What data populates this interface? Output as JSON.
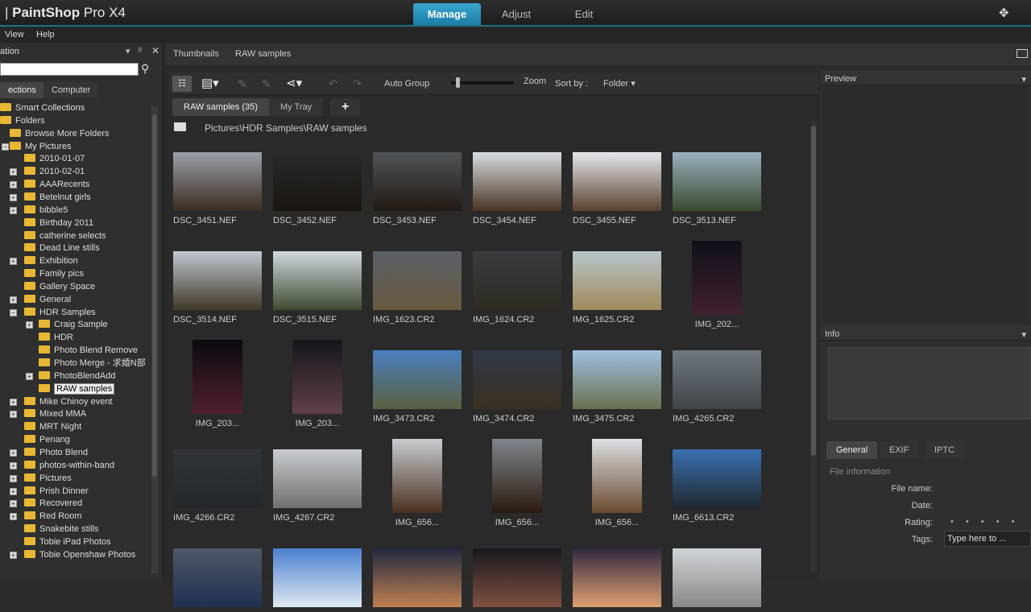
{
  "app": {
    "title_bold": "PaintShop",
    "title_rest": " Pro X4"
  },
  "modes": [
    "Manage",
    "Adjust",
    "Edit"
  ],
  "menu": [
    "View",
    "Help"
  ],
  "nav": {
    "title": "ation",
    "tabs": [
      "ections",
      "Computer"
    ],
    "tree": [
      {
        "label": "Smart Collections",
        "level": 0,
        "exp": ""
      },
      {
        "label": "Folders",
        "level": 0,
        "exp": ""
      },
      {
        "label": "Browse More Folders",
        "level": 1,
        "exp": ""
      },
      {
        "label": "My Pictures",
        "level": 1,
        "exp": "-"
      },
      {
        "label": "2010-01-07",
        "level": 2,
        "exp": ""
      },
      {
        "label": "2010-02-01",
        "level": 2,
        "exp": "+"
      },
      {
        "label": "AAARecents",
        "level": 2,
        "exp": "+"
      },
      {
        "label": "Betelnut girls",
        "level": 2,
        "exp": "+"
      },
      {
        "label": "bibble5",
        "level": 2,
        "exp": "+"
      },
      {
        "label": "Birthday 2011",
        "level": 2,
        "exp": ""
      },
      {
        "label": "catherine selects",
        "level": 2,
        "exp": ""
      },
      {
        "label": "Dead Line stills",
        "level": 2,
        "exp": ""
      },
      {
        "label": "Exhibition",
        "level": 2,
        "exp": "+"
      },
      {
        "label": "Family pics",
        "level": 2,
        "exp": ""
      },
      {
        "label": "Gallery Space",
        "level": 2,
        "exp": ""
      },
      {
        "label": "General",
        "level": 2,
        "exp": "+"
      },
      {
        "label": "HDR Samples",
        "level": 2,
        "exp": "-"
      },
      {
        "label": "Craig Sample",
        "level": 3,
        "exp": "+"
      },
      {
        "label": "HDR",
        "level": 3,
        "exp": ""
      },
      {
        "label": "Photo Blend Remove",
        "level": 3,
        "exp": ""
      },
      {
        "label": "Photo Merge - 求婚N部",
        "level": 3,
        "exp": ""
      },
      {
        "label": "PhotoBlendAdd",
        "level": 3,
        "exp": "+"
      },
      {
        "label": "RAW samples",
        "level": 3,
        "exp": "",
        "selected": true
      },
      {
        "label": "Mike Chinoy event",
        "level": 2,
        "exp": "+"
      },
      {
        "label": "Mixed MMA",
        "level": 2,
        "exp": "+"
      },
      {
        "label": "MRT Night",
        "level": 2,
        "exp": ""
      },
      {
        "label": "Penang",
        "level": 2,
        "exp": ""
      },
      {
        "label": "Photo Blend",
        "level": 2,
        "exp": "+"
      },
      {
        "label": "photos-within-band",
        "level": 2,
        "exp": "+"
      },
      {
        "label": "Pictures",
        "level": 2,
        "exp": "+"
      },
      {
        "label": "Prish Dinner",
        "level": 2,
        "exp": "+"
      },
      {
        "label": "Recovered",
        "level": 2,
        "exp": "+"
      },
      {
        "label": "Red Room",
        "level": 2,
        "exp": "+"
      },
      {
        "label": "Snakebite stills",
        "level": 2,
        "exp": ""
      },
      {
        "label": "Tobie iPad Photos",
        "level": 2,
        "exp": ""
      },
      {
        "label": "Tobie Openshaw Photos",
        "level": 2,
        "exp": "+"
      }
    ]
  },
  "crumbs": [
    "Thumbnails",
    "RAW samples"
  ],
  "toolbar": {
    "auto_group": "Auto Group",
    "zoom": "Zoom",
    "sort_by": "Sort by :",
    "sort_value": "Folder"
  },
  "tray_tabs": [
    "RAW samples (35)",
    "My Tray",
    "+"
  ],
  "path": "Pictures\\HDR Samples\\RAW samples",
  "thumbs": [
    {
      "name": "DSC_3451.NEF",
      "c": [
        "#9aa0a8",
        "#3b2c20"
      ]
    },
    {
      "name": "DSC_3452.NEF",
      "c": [
        "#2a2a2a",
        "#1a1510"
      ]
    },
    {
      "name": "DSC_3453.NEF",
      "c": [
        "#505458",
        "#231a14"
      ]
    },
    {
      "name": "DSC_3454.NEF",
      "c": [
        "#d8dde2",
        "#4a3524"
      ]
    },
    {
      "name": "DSC_3455.NEF",
      "c": [
        "#e6e9ec",
        "#5a4030"
      ]
    },
    {
      "name": "DSC_3513.NEF",
      "c": [
        "#9ab0c0",
        "#3a4a30"
      ]
    },
    {
      "name": "DSC_3514.NEF",
      "c": [
        "#c0c8d0",
        "#403828"
      ]
    },
    {
      "name": "DSC_3515.NEF",
      "c": [
        "#d0d8e0",
        "#404a30"
      ]
    },
    {
      "name": "IMG_1623.CR2",
      "c": [
        "#5a6068",
        "#6a5a40"
      ]
    },
    {
      "name": "IMG_1624.CR2",
      "c": [
        "#3a3c40",
        "#2e2a22"
      ]
    },
    {
      "name": "IMG_1625.CR2",
      "c": [
        "#b8c4cc",
        "#a08a5a"
      ]
    },
    {
      "name": "IMG_202...",
      "c": [
        "#101018",
        "#402030"
      ],
      "portrait": true
    },
    {
      "name": "IMG_203...",
      "c": [
        "#0a0a10",
        "#502030"
      ],
      "portrait": true
    },
    {
      "name": "IMG_203...",
      "c": [
        "#15151c",
        "#604048"
      ],
      "portrait": true
    },
    {
      "name": "IMG_3473.CR2",
      "c": [
        "#4a80c0",
        "#5a6040"
      ]
    },
    {
      "name": "IMG_3474.CR2",
      "c": [
        "#303848",
        "#3a3020"
      ]
    },
    {
      "name": "IMG_3475.CR2",
      "c": [
        "#a0c0e0",
        "#6a7050"
      ]
    },
    {
      "name": "IMG_4265.CR2",
      "c": [
        "#707880",
        "#404448"
      ]
    },
    {
      "name": "IMG_4266.CR2",
      "c": [
        "#303438",
        "#25282a"
      ]
    },
    {
      "name": "IMG_4267.CR2",
      "c": [
        "#c8ccd0",
        "#707070"
      ]
    },
    {
      "name": "IMG_656...",
      "c": [
        "#c8ccd0",
        "#4a3020"
      ],
      "portrait": true
    },
    {
      "name": "IMG_656...",
      "c": [
        "#80868c",
        "#2a1a10"
      ],
      "portrait": true
    },
    {
      "name": "IMG_656...",
      "c": [
        "#dde0e4",
        "#6a4a30"
      ],
      "portrait": true
    },
    {
      "name": "IMG_6613.CR2",
      "c": [
        "#3a70b0",
        "#202830"
      ]
    },
    {
      "name": "",
      "c": [
        "#505868",
        "#203050"
      ]
    },
    {
      "name": "",
      "c": [
        "#4a80d0",
        "#e0e8f0"
      ]
    },
    {
      "name": "",
      "c": [
        "#202840",
        "#c08050"
      ]
    },
    {
      "name": "",
      "c": [
        "#181820",
        "#805040"
      ]
    },
    {
      "name": "",
      "c": [
        "#302840",
        "#e0a070"
      ]
    },
    {
      "name": "",
      "c": [
        "#d0d4d8",
        "#888"
      ]
    }
  ],
  "right": {
    "preview": "Preview",
    "info": "Info",
    "tabs": [
      "General",
      "EXIF",
      "IPTC"
    ],
    "file_info": "File information",
    "fields": [
      "File name:",
      "Date:",
      "Rating:",
      "Tags:"
    ],
    "rating_dots": "• • • • •",
    "tags_placeholder": "Type here to ..."
  }
}
